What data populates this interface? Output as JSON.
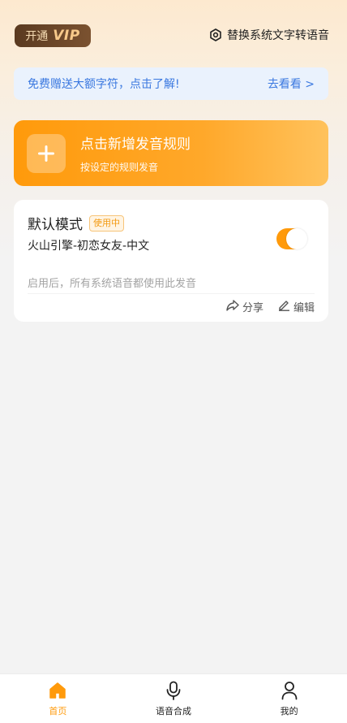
{
  "header": {
    "vip_prefix": "开通",
    "vip_word": "VIP",
    "replace_label": "替换系统文字转语音",
    "replace_icon": "gear-hex-icon"
  },
  "promo": {
    "text": "免费赠送大额字符，点击了解!",
    "link": "去看看 >"
  },
  "add_rule": {
    "title": "点击新增发音规则",
    "subtitle": "按设定的规则发音",
    "icon": "plus-icon"
  },
  "mode_card": {
    "title": "默认模式",
    "badge": "使用中",
    "engine": "火山引擎-初恋女友-中文",
    "description": "启用后，所有系统语音都使用此发音",
    "toggle_on": true,
    "share_label": "分享",
    "edit_label": "编辑"
  },
  "bottom_nav": {
    "items": [
      {
        "label": "首页",
        "icon": "home-icon",
        "active": true
      },
      {
        "label": "语音合成",
        "icon": "microphone-icon",
        "active": false
      },
      {
        "label": "我的",
        "icon": "user-icon",
        "active": false
      }
    ]
  },
  "colors": {
    "accent": "#ff9a0b",
    "promo_text": "#3a78e0",
    "vip_bg": "#5a3a20"
  }
}
